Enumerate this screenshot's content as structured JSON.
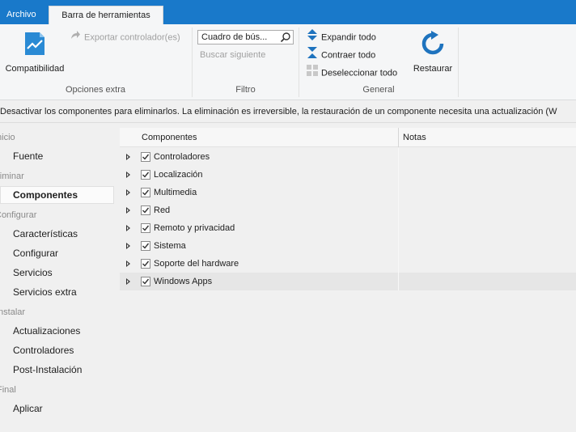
{
  "tabs": {
    "file": "Archivo",
    "toolbar": "Barra de herramientas"
  },
  "ribbon": {
    "compat": {
      "label": "Compatibilidad"
    },
    "export_drivers": {
      "label": "Exportar controlador(es)"
    },
    "search": {
      "placeholder": "Cuadro de bús..."
    },
    "find_next": {
      "label": "Buscar siguiente"
    },
    "expand_all": {
      "label": "Expandir todo"
    },
    "collapse_all": {
      "label": "Contraer todo"
    },
    "deselect_all": {
      "label": "Deseleccionar todo"
    },
    "restore": {
      "label": "Restaurar"
    },
    "groups": {
      "extra": "Opciones extra",
      "filter": "Filtro",
      "general": "General"
    }
  },
  "infobar": {
    "text": "Desactivar los componentes para eliminarlos. La eliminación es irreversible, la restauración de un componente necesita una actualización (W"
  },
  "nav": {
    "sections": [
      {
        "title": "Inicio",
        "items": [
          "Fuente"
        ]
      },
      {
        "title": "Eliminar",
        "items": [
          "Componentes"
        ]
      },
      {
        "title": "Configurar",
        "items": [
          "Características",
          "Configurar",
          "Servicios",
          "Servicios extra"
        ]
      },
      {
        "title": "Instalar",
        "items": [
          "Actualizaciones",
          "Controladores",
          "Post-Instalación"
        ]
      },
      {
        "title": "Final",
        "items": [
          "Aplicar"
        ]
      }
    ],
    "selected": "Componentes"
  },
  "grid": {
    "columns": [
      "Componentes",
      "Notas"
    ],
    "rows": [
      {
        "name": "Controladores",
        "checked": true
      },
      {
        "name": "Localización",
        "checked": true
      },
      {
        "name": "Multimedia",
        "checked": true
      },
      {
        "name": "Red",
        "checked": true
      },
      {
        "name": "Remoto y privacidad",
        "checked": true
      },
      {
        "name": "Sistema",
        "checked": true
      },
      {
        "name": "Soporte del hardware",
        "checked": true
      },
      {
        "name": "Windows Apps",
        "checked": true
      }
    ]
  },
  "colors": {
    "accent": "#1979ca",
    "icon_blue": "#1e73be"
  }
}
